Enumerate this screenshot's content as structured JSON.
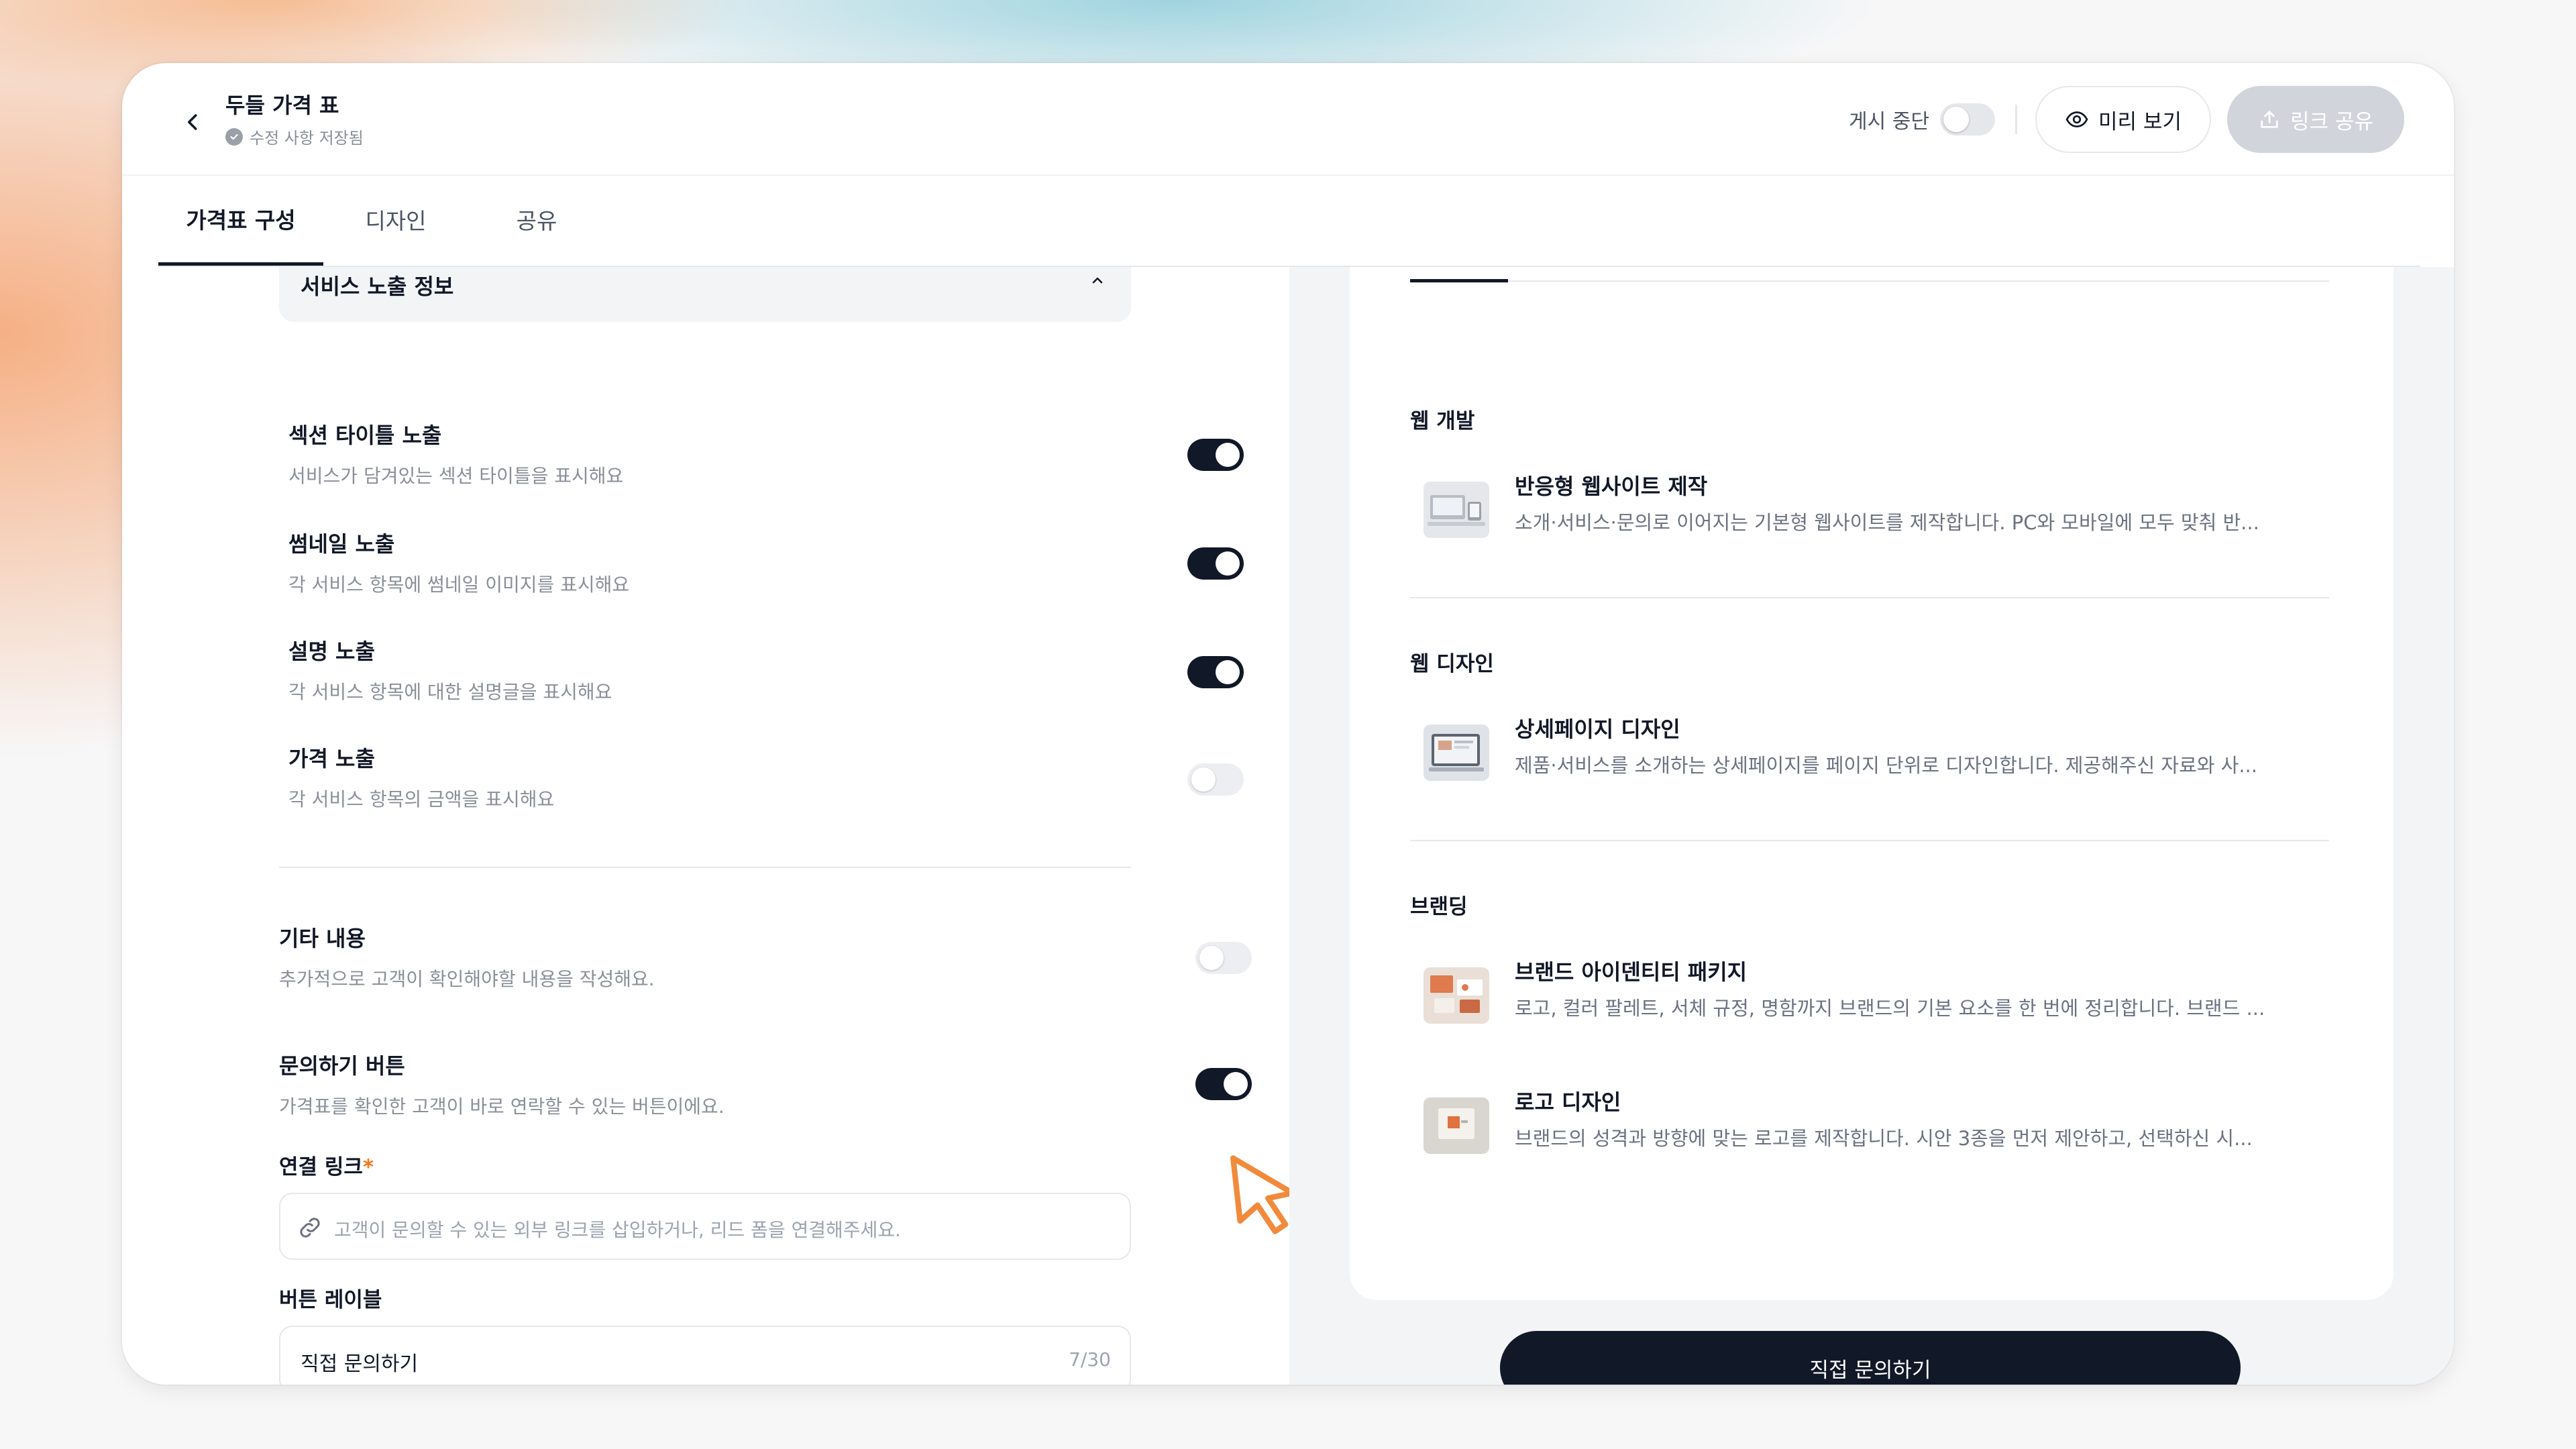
{
  "header": {
    "title": "두들 가격 표",
    "save_status": "수정 사항 저장됨",
    "pause_label": "게시 중단",
    "pause_on": false,
    "preview_label": "미리 보기",
    "share_label": "링크 공유"
  },
  "tabs": [
    {
      "label": "가격표 구성",
      "active": true
    },
    {
      "label": "디자인",
      "active": false
    },
    {
      "label": "공유",
      "active": false
    }
  ],
  "settings": {
    "section_title": "서비스 노출 정보",
    "options": [
      {
        "title": "섹션 타이틀 노출",
        "desc": "서비스가 담겨있는 섹션 타이틀을 표시해요",
        "on": true
      },
      {
        "title": "썸네일 노출",
        "desc": "각 서비스 항목에 썸네일 이미지를 표시해요",
        "on": true
      },
      {
        "title": "설명 노출",
        "desc": "각 서비스 항목에 대한 설명글을 표시해요",
        "on": true
      },
      {
        "title": "가격 노출",
        "desc": "각 서비스 항목의 금액을 표시해요",
        "on": false
      }
    ],
    "extra": {
      "title": "기타 내용",
      "desc": "추가적으로 고객이 확인해야할 내용을 작성해요.",
      "on": false
    },
    "inquiry": {
      "title": "문의하기 버튼",
      "desc": "가격표를 확인한 고객이 바로 연락할 수 있는 버튼이에요.",
      "on": true
    },
    "link_field": {
      "label": "연결 링크",
      "required_mark": "*",
      "placeholder": "고객이 문의할 수 있는 외부 링크를 삽입하거나, 리드 폼을 연결해주세요."
    },
    "button_label_field": {
      "label": "버튼 레이블",
      "value": "직접 문의하기",
      "counter": "7/30"
    }
  },
  "preview": {
    "categories": [
      {
        "title": "웹 개발",
        "services": [
          {
            "name": "반응형 웹사이트 제작",
            "desc": "소개·서비스·문의로 이어지는 기본형 웹사이트를 제작합니다. PC와 모바일에 모두 맞춰 반..."
          }
        ]
      },
      {
        "title": "웹 디자인",
        "services": [
          {
            "name": "상세페이지 디자인",
            "desc": "제품·서비스를 소개하는 상세페이지를 페이지 단위로 디자인합니다. 제공해주신 자료와 사..."
          }
        ]
      },
      {
        "title": "브랜딩",
        "services": [
          {
            "name": "브랜드 아이덴티티 패키지",
            "desc": "로고, 컬러 팔레트, 서체 규정, 명함까지 브랜드의 기본 요소를 한 번에 정리합니다. 브랜드 ..."
          },
          {
            "name": "로고 디자인",
            "desc": "브랜드의 성격과 방향에 맞는 로고를 제작합니다. 시안 3종을 먼저 제안하고, 선택하신 시..."
          }
        ]
      }
    ],
    "cta_label": "직접 문의하기"
  },
  "colors": {
    "accent": "#111827",
    "toggle_off": "#eceef1",
    "required": "#f97316",
    "cursor": "#f28a3c"
  }
}
